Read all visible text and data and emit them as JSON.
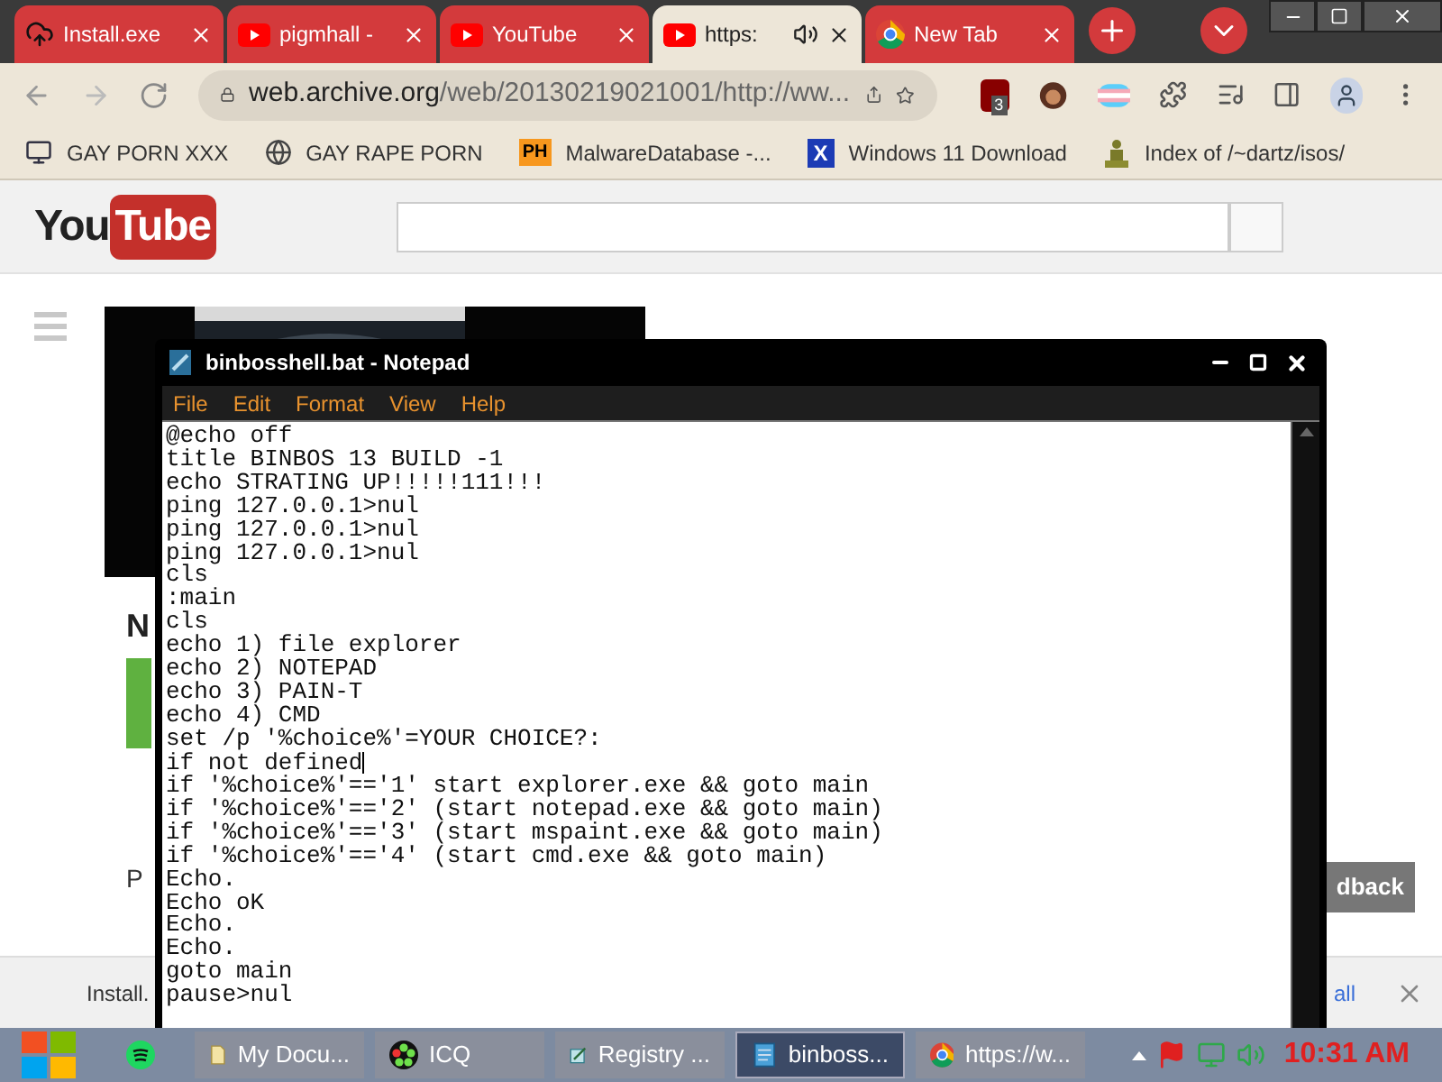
{
  "browser": {
    "tabs": [
      {
        "title": "Install.exe",
        "kind": "cloud",
        "selected": false,
        "audio": false
      },
      {
        "title": "pigmhall -",
        "kind": "video",
        "selected": false,
        "audio": false
      },
      {
        "title": "YouTube",
        "kind": "video",
        "selected": false,
        "audio": false
      },
      {
        "title": "https:",
        "kind": "video",
        "selected": true,
        "audio": true
      },
      {
        "title": "New Tab",
        "kind": "browser",
        "selected": false,
        "audio": false
      }
    ],
    "address": {
      "domain": "web.archive.org",
      "path": "/web/20130219021001/http://ww..."
    },
    "extension_badge": "3",
    "bookmarks": [
      {
        "label": "GAY PORN XXX"
      },
      {
        "label": "GAY RAPE PORN"
      },
      {
        "label": "MalwareDatabase -...",
        "icon_text": "PH"
      },
      {
        "label": "Windows 11 Download",
        "icon_text": "X"
      },
      {
        "label": "Index of /~dartz/isos/"
      }
    ]
  },
  "page": {
    "logo": {
      "left": "You",
      "right": "Tube"
    },
    "heading_letter": "N",
    "second_letter": "P",
    "feedback": "dback",
    "download": {
      "file": "Install.",
      "link": "all"
    }
  },
  "notepad": {
    "title": "binbosshell.bat - Notepad",
    "menu": [
      "File",
      "Edit",
      "Format",
      "View",
      "Help"
    ],
    "lines": [
      {
        "text": "@echo off",
        "caret": false
      },
      {
        "text": "title BINBOS 13 BUILD -1",
        "caret": false
      },
      {
        "text": "echo STRATING UP!!!!!111!!!",
        "caret": false
      },
      {
        "text": "ping 127.0.0.1>nul",
        "caret": false
      },
      {
        "text": "ping 127.0.0.1>nul",
        "caret": false
      },
      {
        "text": "ping 127.0.0.1>nul",
        "caret": false
      },
      {
        "text": "cls",
        "caret": false
      },
      {
        "text": ":main",
        "caret": false
      },
      {
        "text": "cls",
        "caret": false
      },
      {
        "text": "echo 1) file explorer",
        "caret": false
      },
      {
        "text": "echo 2) NOTEPAD",
        "caret": false
      },
      {
        "text": "echo 3) PAIN-T",
        "caret": false
      },
      {
        "text": "echo 4) CMD",
        "caret": false
      },
      {
        "text": "set /p '%choice%'=YOUR CHOICE?:",
        "caret": false
      },
      {
        "text": "if not defined",
        "caret": true
      },
      {
        "text": "if '%choice%'=='1' start explorer.exe && goto main",
        "caret": false
      },
      {
        "text": "if '%choice%'=='2' (start notepad.exe && goto main)",
        "caret": false
      },
      {
        "text": "if '%choice%'=='3' (start mspaint.exe && goto main)",
        "caret": false
      },
      {
        "text": "if '%choice%'=='4' (start cmd.exe && goto main)",
        "caret": false
      },
      {
        "text": "Echo.",
        "caret": false
      },
      {
        "text": "Echo oK",
        "caret": false
      },
      {
        "text": "Echo.",
        "caret": false
      },
      {
        "text": "Echo.",
        "caret": false
      },
      {
        "text": "goto main",
        "caret": false
      },
      {
        "text": "pause>nul",
        "caret": false
      }
    ]
  },
  "taskbar": {
    "items": [
      {
        "label": "My Docu...",
        "selected": false
      },
      {
        "label": "ICQ",
        "selected": false
      },
      {
        "label": "Registry ...",
        "selected": false
      },
      {
        "label": "binboss...",
        "selected": true
      },
      {
        "label": "https://w...",
        "selected": false
      }
    ],
    "clock": "10:31 AM"
  }
}
